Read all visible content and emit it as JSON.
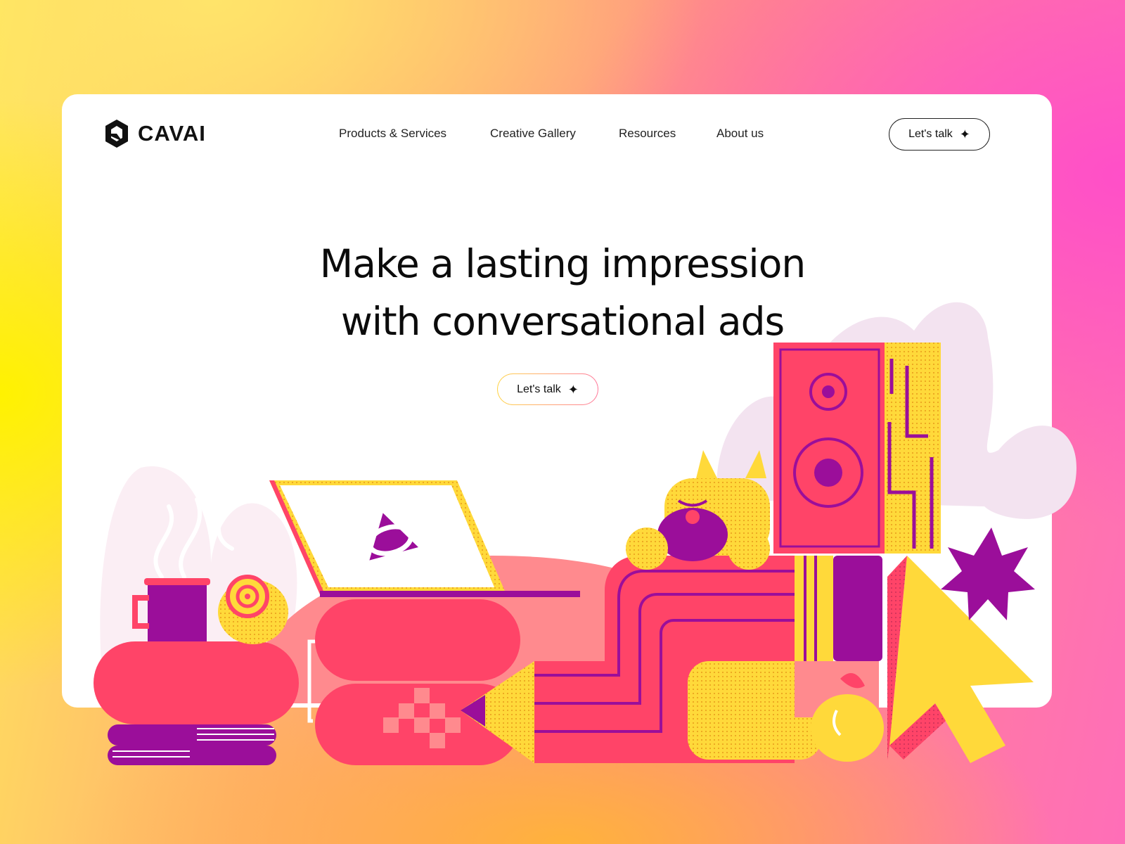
{
  "brand": {
    "name": "CAVAI",
    "logo_icon": "cavai-logo-icon"
  },
  "nav": {
    "items": [
      {
        "label": "Products & Services"
      },
      {
        "label": "Creative Gallery"
      },
      {
        "label": "Resources"
      },
      {
        "label": "About us"
      }
    ]
  },
  "header_cta": {
    "label": "Let's talk",
    "icon": "sparkle-icon"
  },
  "hero": {
    "line1": "Make a lasting impression",
    "line2": "with conversational ads",
    "cta": {
      "label": "Let's talk",
      "icon": "sparkle-icon"
    }
  },
  "colors": {
    "pink": "#ff4468",
    "magenta": "#9b0e9a",
    "yellow": "#ffd93a",
    "salmon": "#ff8a8e",
    "lilac": "#f3e3f0"
  }
}
